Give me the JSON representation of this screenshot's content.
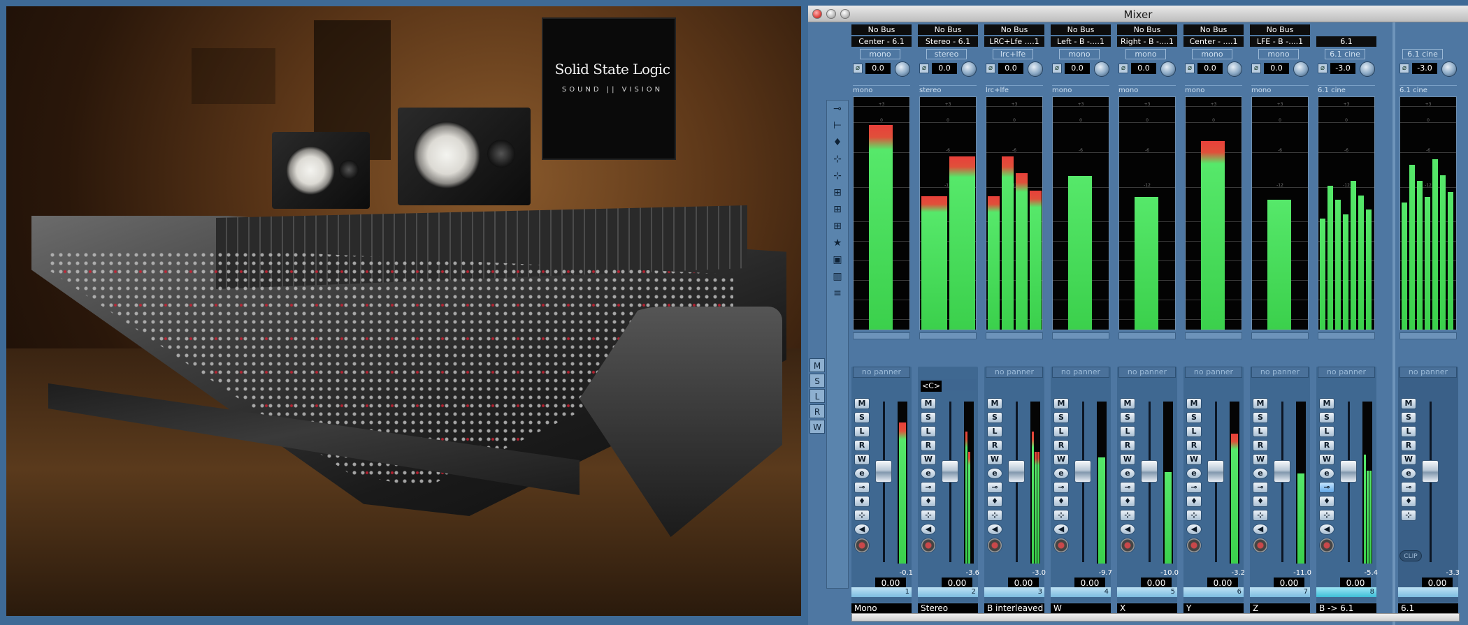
{
  "photo": {
    "tv_brand": "Solid State Logic",
    "tv_subtitle": "SOUND || VISION"
  },
  "window": {
    "title": "Mixer"
  },
  "left_rail_icons": [
    "input-icon",
    "insert-icon",
    "eq-icon",
    "send-icon",
    "send2-icon",
    "bus1-icon",
    "bus2-icon",
    "bus3-icon",
    "star-icon",
    "square-icon",
    "meter-icon",
    "stack-icon"
  ],
  "left_column_buttons": [
    "M",
    "S",
    "L",
    "R",
    "W"
  ],
  "channels": [
    {
      "bus": "No Bus",
      "route": "Center - 6.1",
      "config": "mono",
      "gain": "0.0",
      "label": "mono",
      "name": "Mono",
      "num": "1",
      "vol": "0.00",
      "peak": "-0.1",
      "level": 0.88,
      "hot": true,
      "fader": 0.58
    },
    {
      "bus": "No Bus",
      "route": "Stereo - 6.1",
      "config": "stereo",
      "gain": "0.0",
      "label": "stereo",
      "name": "Stereo",
      "num": "2",
      "vol": "0.00",
      "peak": "-3.6",
      "level": 0.82,
      "hot": true,
      "fader": 0.58,
      "pan": "<C>"
    },
    {
      "bus": "No Bus",
      "route": "LRC+Lfe ....1",
      "config": "lrc+lfe",
      "gain": "0.0",
      "label": "lrc+lfe",
      "name": "B interleaved",
      "num": "3",
      "vol": "0.00",
      "peak": "-3.0",
      "level": 0.82,
      "hot": true,
      "fader": 0.58
    },
    {
      "bus": "No Bus",
      "route": "Left - B -....1",
      "config": "mono",
      "gain": "0.0",
      "label": "mono",
      "name": "W",
      "num": "4",
      "vol": "0.00",
      "peak": "-9.7",
      "level": 0.66,
      "hot": false,
      "fader": 0.58
    },
    {
      "bus": "No Bus",
      "route": "Right - B -....1",
      "config": "mono",
      "gain": "0.0",
      "label": "mono",
      "name": "X",
      "num": "5",
      "vol": "0.00",
      "peak": "-10.0",
      "level": 0.57,
      "hot": false,
      "fader": 0.58
    },
    {
      "bus": "No Bus",
      "route": "Center - ....1",
      "config": "mono",
      "gain": "0.0",
      "label": "mono",
      "name": "Y",
      "num": "6",
      "vol": "0.00",
      "peak": "-3.2",
      "level": 0.81,
      "hot": true,
      "fader": 0.58
    },
    {
      "bus": "No Bus",
      "route": "LFE - B -....1",
      "config": "mono",
      "gain": "0.0",
      "label": "mono",
      "name": "Z",
      "num": "7",
      "vol": "0.00",
      "peak": "-11.0",
      "level": 0.56,
      "hot": false,
      "fader": 0.58
    },
    {
      "bus": "",
      "route": "6.1",
      "config": "6.1 cine",
      "gain": "-3.0",
      "label": "6.1 cine",
      "name": "B -> 6.1",
      "num": "8",
      "vol": "0.00",
      "peak": "-5.4",
      "level": 0.68,
      "hot": false,
      "fader": 0.58,
      "selected": true
    }
  ],
  "master": {
    "config": "6.1 cine",
    "gain": "-3.0",
    "label": "6.1 cine",
    "name": "6.1",
    "vol": "0.00",
    "peak": "-3.3",
    "level": 0.78,
    "clip": "CLIP"
  },
  "strip_buttons": {
    "mute": "M",
    "solo": "S",
    "listen": "L",
    "read": "R",
    "write": "W",
    "edit": "e"
  },
  "no_panner": "no panner",
  "colors": {
    "meter_green": "#3bd04c",
    "meter_red": "#e8403a",
    "window_blue": "#4e77a2"
  }
}
